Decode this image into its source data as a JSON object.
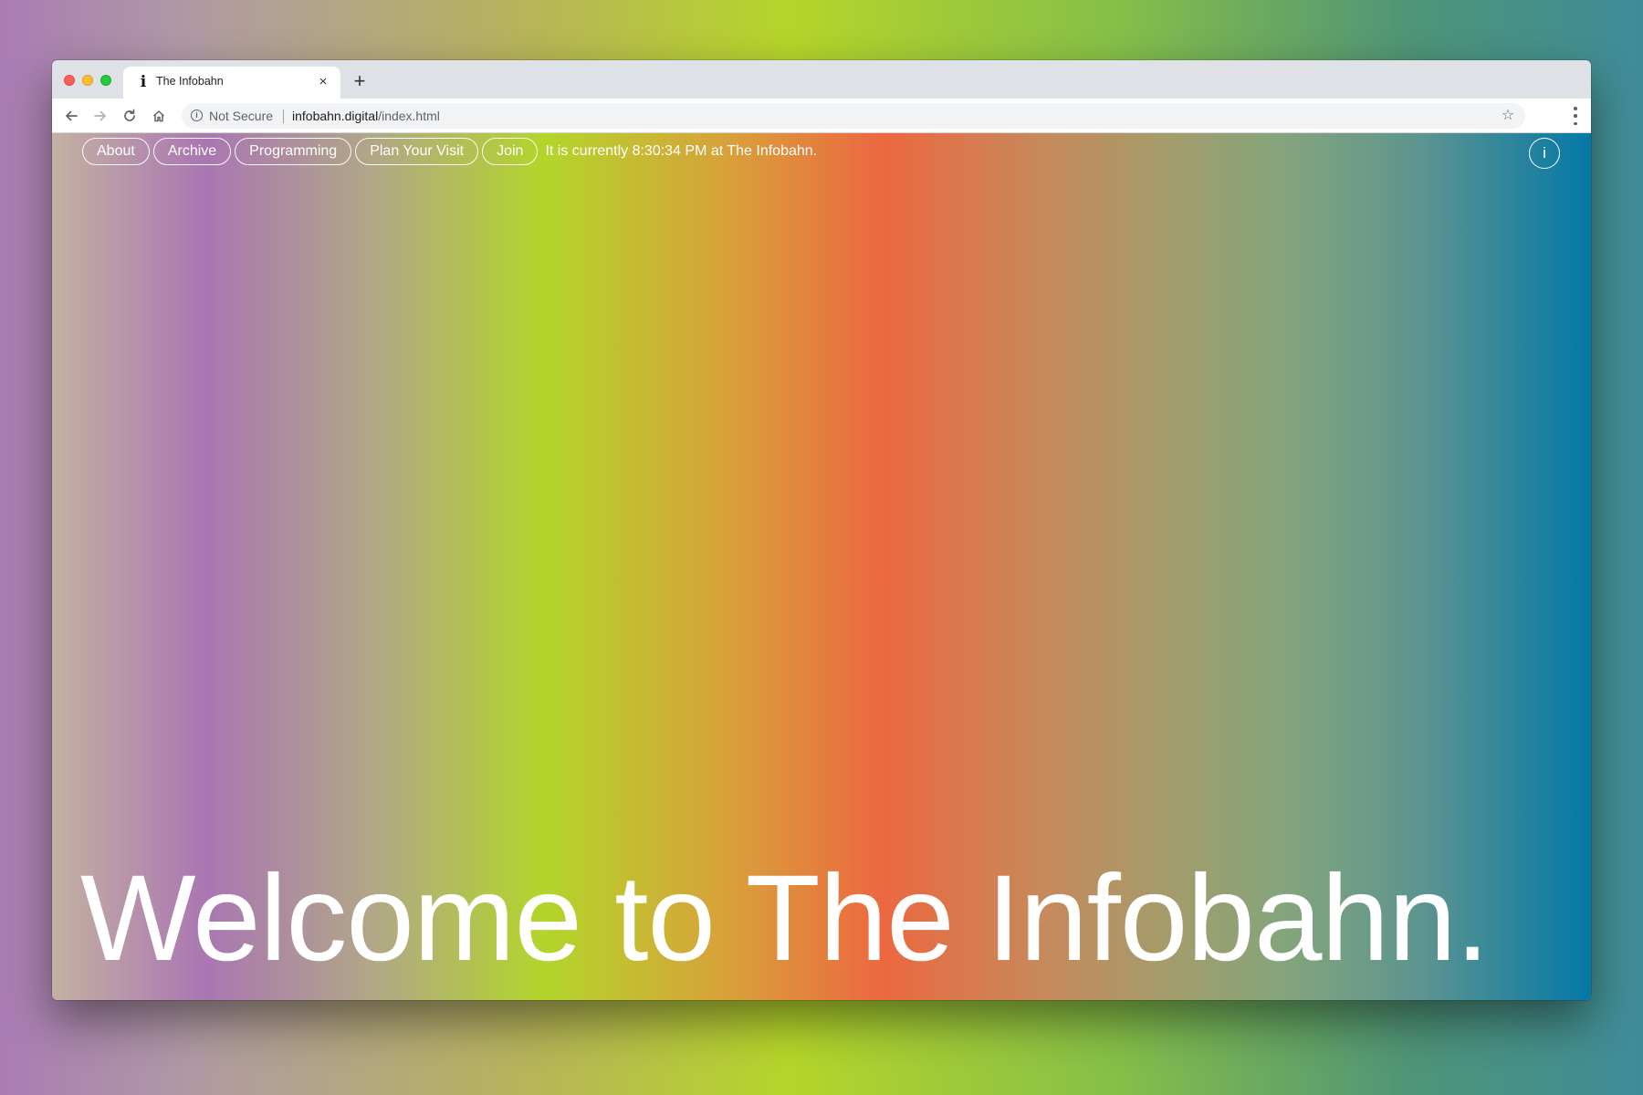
{
  "browser": {
    "tab": {
      "favicon": "i",
      "title": "The Infobahn",
      "close": "×"
    },
    "new_tab": "+",
    "toolbar": {
      "security_label": "Not Secure",
      "url_domain": "infobahn.digital",
      "url_path": "/index.html"
    },
    "icons": [
      "back-arrow-icon",
      "forward-arrow-icon",
      "reload-icon",
      "home-icon",
      "info-icon",
      "star-icon",
      "menu-dots-icon"
    ]
  },
  "site": {
    "nav": [
      {
        "label": "About"
      },
      {
        "label": "Archive"
      },
      {
        "label": "Programming"
      },
      {
        "label": "Plan Your Visit"
      },
      {
        "label": "Join"
      }
    ],
    "clock_text": "It is currently 8:30:34 PM at The Infobahn.",
    "info_button": "i",
    "hero": "Welcome to The Infobahn."
  },
  "colors": {
    "gradient": [
      "#c4b1a1",
      "#aa76b3",
      "#b3d52a",
      "#ec6840",
      "#0478a8"
    ],
    "text": "#ffffff"
  }
}
